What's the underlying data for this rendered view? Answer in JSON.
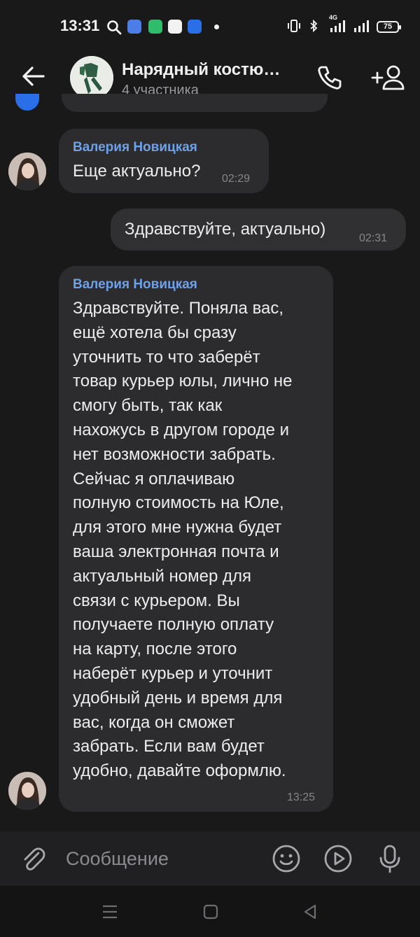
{
  "status_bar": {
    "time": "13:31",
    "battery": "75",
    "network": "4G",
    "icons": [
      "search-icon",
      "app-icon",
      "app-icon",
      "app-icon",
      "bluetooth-app-icon",
      "vibrate-icon",
      "bluetooth-icon",
      "signal-icon",
      "signal-icon",
      "battery-icon"
    ]
  },
  "header": {
    "title": "Нарядный костю…",
    "subtitle": "4 участника",
    "back_icon": "arrow-left-icon",
    "call_icon": "phone-icon",
    "add_icon": "add-user-icon"
  },
  "messages": [
    {
      "direction": "in",
      "sender": "Валерия Новицкая",
      "lines": [
        "Еще актуально?"
      ],
      "time": "02:29"
    },
    {
      "direction": "out",
      "lines": [
        "Здравствуйте, актуально)"
      ],
      "time": "02:31"
    },
    {
      "direction": "in",
      "sender": "Валерия Новицкая",
      "lines": [
        "Здравствуйте. Поняла вас,",
        "ещё хотела бы сразу",
        "уточнить то что заберёт",
        "товар курьер юлы, лично не",
        "смогу быть, так как",
        "нахожусь в другом городе и",
        "нет возможности забрать.",
        "Сейчас я оплачиваю",
        "полную стоимость на Юле,",
        "для этого мне нужна будет",
        "ваша электронная почта и",
        "актуальный номер для",
        "связи с курьером. Вы",
        "получаете полную оплату",
        "на карту, после этого",
        "наберёт курьер и уточнит",
        "удобный день и время для",
        "вас, когда он сможет",
        "забрать. Если вам будет",
        "удобно, давайте оформлю."
      ],
      "time": "13:25"
    }
  ],
  "input": {
    "placeholder": "Сообщение",
    "icons": [
      "paperclip-icon",
      "emoji-icon",
      "video-message-icon",
      "microphone-icon"
    ]
  },
  "nav": {
    "icons": [
      "menu-icon",
      "home-icon",
      "back-icon"
    ]
  },
  "colors": {
    "background": "#19191a",
    "bubble_in": "#2c2c2e",
    "bubble_out": "#303033",
    "sender_name": "#6fa1e8",
    "time_text": "#86868a"
  }
}
